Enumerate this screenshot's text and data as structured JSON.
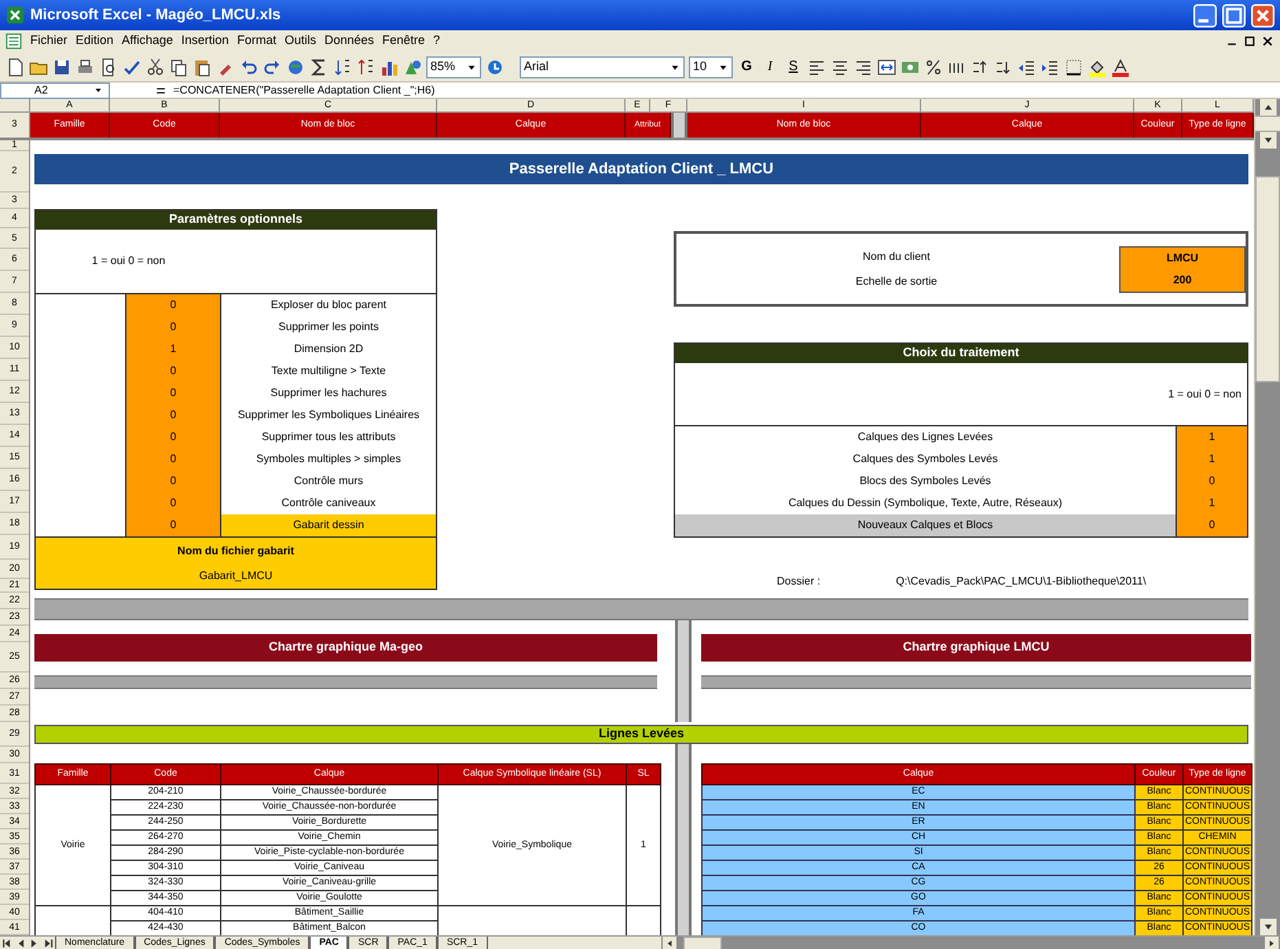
{
  "window": {
    "title": "Microsoft Excel - Magéo_LMCU.xls"
  },
  "menu": [
    "Fichier",
    "Edition",
    "Affichage",
    "Insertion",
    "Format",
    "Outils",
    "Données",
    "Fenêtre",
    "?"
  ],
  "toolbar": {
    "zoom": "85%",
    "font": "Arial",
    "font_size": "10",
    "bold": "G",
    "italic": "I",
    "underline": "S"
  },
  "formula_bar": {
    "cell": "A2",
    "formula": "=CONCATENER(\"Passerelle Adaptation Client _\";H6)"
  },
  "columns": [
    "A",
    "B",
    "C",
    "D",
    "E",
    "F",
    "I",
    "J",
    "K",
    "L"
  ],
  "frozen_row": {
    "number": "3",
    "cells": [
      "Famille",
      "Code",
      "Nom de bloc",
      "Calque",
      "Attribut",
      "Nom de bloc",
      "Calque",
      "Couleur",
      "Type de ligne"
    ]
  },
  "row_numbers": [
    "1",
    "2",
    "3",
    "4",
    "5",
    "6",
    "7",
    "8",
    "9",
    "10",
    "11",
    "12",
    "13",
    "14",
    "15",
    "16",
    "17",
    "18",
    "19",
    "20",
    "21",
    "22",
    "23",
    "24",
    "25",
    "26",
    "27",
    "28",
    "29",
    "30",
    "31",
    "32",
    "33",
    "34",
    "35",
    "36",
    "37",
    "38",
    "39",
    "40",
    "41"
  ],
  "banner": "Passerelle Adaptation Client _ LMCU",
  "options_panel": {
    "title": "Paramètres optionnels",
    "legend": "1 = oui 0 = non",
    "options": [
      {
        "value": "0",
        "label": "Exploser du bloc parent",
        "highlighted": false
      },
      {
        "value": "0",
        "label": "Supprimer les points",
        "highlighted": false
      },
      {
        "value": "1",
        "label": "Dimension 2D",
        "highlighted": false
      },
      {
        "value": "0",
        "label": "Texte multiligne > Texte",
        "highlighted": false
      },
      {
        "value": "0",
        "label": "Supprimer les hachures",
        "highlighted": false
      },
      {
        "value": "0",
        "label": "Supprimer les Symboliques Linéaires",
        "highlighted": false
      },
      {
        "value": "0",
        "label": "Supprimer tous les attributs",
        "highlighted": false
      },
      {
        "value": "0",
        "label": "Symboles multiples > simples",
        "highlighted": false
      },
      {
        "value": "0",
        "label": "Contrôle murs",
        "highlighted": false
      },
      {
        "value": "0",
        "label": "Contrôle caniveaux",
        "highlighted": false
      },
      {
        "value": "0",
        "label": "Gabarit dessin",
        "highlighted": true
      }
    ],
    "template_label": "Nom du fichier gabarit",
    "template": "Gabarit_LMCU"
  },
  "client_panel": {
    "fields": [
      {
        "label": "Nom du client",
        "value": "LMCU"
      },
      {
        "label": "Echelle de sortie",
        "value": "200"
      }
    ]
  },
  "processing_panel": {
    "title": "Choix du traitement",
    "legend": "1 = oui 0 = non",
    "items": [
      {
        "label": "Calques des Lignes Levées",
        "value": "1",
        "shaded": false
      },
      {
        "label": "Calques des Symboles Levés",
        "value": "1",
        "shaded": false
      },
      {
        "label": "Blocs des Symboles Levés",
        "value": "0",
        "shaded": false
      },
      {
        "label": "Calques du Dessin (Symbolique, Texte, Autre, Réseaux)",
        "value": "1",
        "shaded": false
      },
      {
        "label": "Nouveaux Calques et Blocs",
        "value": "0",
        "shaded": true
      }
    ]
  },
  "folder": {
    "label": "Dossier :",
    "path": "Q:\\Cevadis_Pack\\PAC_LMCU\\1-Bibliotheque\\2011\\"
  },
  "charters": [
    "Chartre graphique Ma-geo",
    "Chartre graphique LMCU"
  ],
  "section_title": "Lignes Levées",
  "table": {
    "left_columns": [
      "Famille",
      "Code",
      "Calque",
      "Calque Symbolique linéaire (SL)",
      "SL"
    ],
    "right_columns": [
      "Calque",
      "Couleur",
      "Type de ligne"
    ],
    "groups": [
      {
        "family": "Voirie",
        "symbolic_layer": "Voirie_Symbolique",
        "sl": "1",
        "rows": [
          {
            "code": "204-210",
            "layer": "Voirie_Chaussée-bordurée",
            "target": "EC",
            "colour_name": "Blanc",
            "line_type": "CONTINUOUS"
          },
          {
            "code": "224-230",
            "layer": "Voirie_Chaussée-non-bordurée",
            "target": "EN",
            "colour_name": "Blanc",
            "line_type": "CONTINUOUS"
          },
          {
            "code": "244-250",
            "layer": "Voirie_Bordurette",
            "target": "ER",
            "colour_name": "Blanc",
            "line_type": "CONTINUOUS"
          },
          {
            "code": "264-270",
            "layer": "Voirie_Chemin",
            "target": "CH",
            "colour_name": "Blanc",
            "line_type": "CHEMIN"
          },
          {
            "code": "284-290",
            "layer": "Voirie_Piste-cyclable-non-bordurée",
            "target": "SI",
            "colour_name": "Blanc",
            "line_type": "CONTINUOUS"
          },
          {
            "code": "304-310",
            "layer": "Voirie_Caniveau",
            "target": "CA",
            "colour_name": "26",
            "line_type": "CONTINUOUS"
          },
          {
            "code": "324-330",
            "layer": "Voirie_Caniveau-grille",
            "target": "CG",
            "colour_name": "26",
            "line_type": "CONTINUOUS"
          },
          {
            "code": "344-350",
            "layer": "Voirie_Goulotte",
            "target": "GO",
            "colour_name": "Blanc",
            "line_type": "CONTINUOUS"
          }
        ]
      },
      {
        "rows": [
          {
            "code": "404-410",
            "layer": "Bâtiment_Saillie",
            "target": "FA",
            "colour_name": "Blanc",
            "line_type": "CONTINUOUS"
          },
          {
            "code": "424-430",
            "layer": "Bâtiment_Balcon",
            "target": "CO",
            "colour_name": "Blanc",
            "line_type": "CONTINUOUS"
          }
        ]
      }
    ]
  },
  "sheet_tabs": [
    {
      "label": "Nomenclature",
      "selected": false
    },
    {
      "label": "Codes_Lignes",
      "selected": false
    },
    {
      "label": "Codes_Symboles",
      "selected": false
    },
    {
      "label": "PAC",
      "selected": true
    },
    {
      "label": "SCR",
      "selected": false
    },
    {
      "label": "PAC_1",
      "selected": false
    },
    {
      "label": "SCR_1",
      "selected": false
    }
  ]
}
